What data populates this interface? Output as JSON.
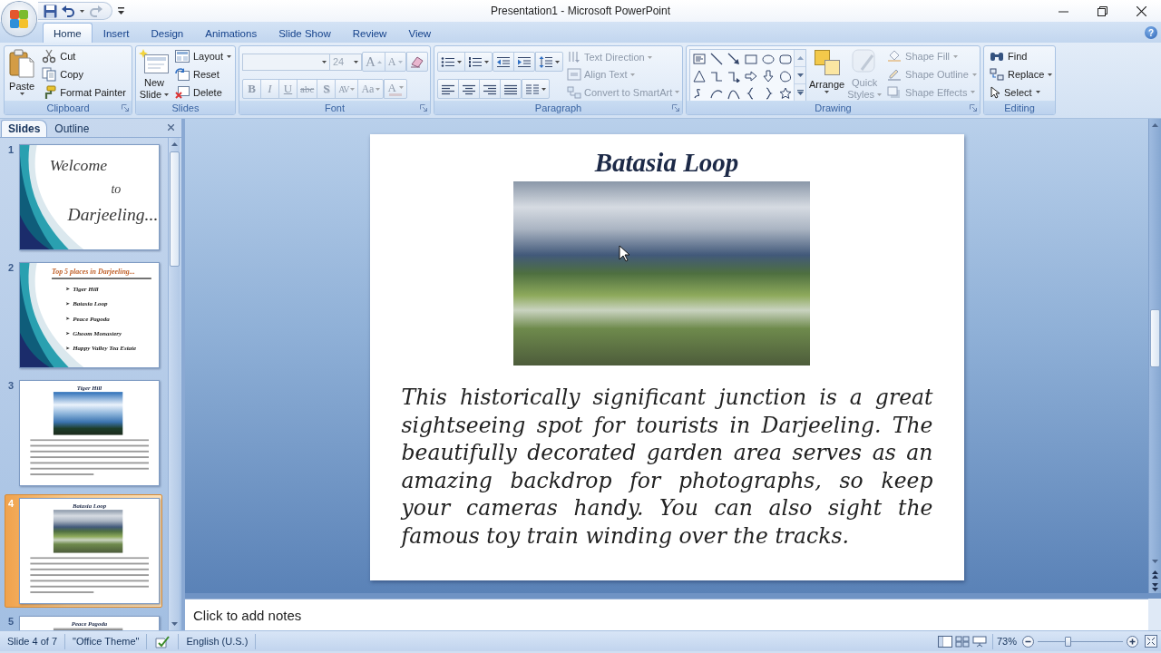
{
  "window": {
    "title": "Presentation1 - Microsoft PowerPoint",
    "help": "?"
  },
  "tabs": [
    {
      "label": "Home",
      "selected": true
    },
    {
      "label": "Insert",
      "selected": false
    },
    {
      "label": "Design",
      "selected": false
    },
    {
      "label": "Animations",
      "selected": false
    },
    {
      "label": "Slide Show",
      "selected": false
    },
    {
      "label": "Review",
      "selected": false
    },
    {
      "label": "View",
      "selected": false
    }
  ],
  "ribbon": {
    "clipboard": {
      "label": "Clipboard",
      "paste": "Paste",
      "cut": "Cut",
      "copy": "Copy",
      "format_painter": "Format Painter"
    },
    "slides": {
      "label": "Slides",
      "new_slide": [
        "New",
        "Slide"
      ],
      "layout": "Layout",
      "reset": "Reset",
      "delete": "Delete"
    },
    "font": {
      "label": "Font",
      "disabled": true,
      "font_size": "24",
      "grow": "A",
      "shrink": "A",
      "format_buttons": [
        {
          "kind": "bold",
          "label": "B"
        },
        {
          "kind": "italic",
          "label": "I"
        },
        {
          "kind": "underline",
          "label": "U"
        },
        {
          "kind": "strikethrough",
          "label": "abc"
        },
        {
          "kind": "shadow",
          "label": "S"
        },
        {
          "kind": "spacing",
          "label": "AV"
        },
        {
          "kind": "case",
          "label": "Aa"
        }
      ],
      "font_color": "A"
    },
    "paragraph": {
      "label": "Paragraph",
      "commands": [
        {
          "label": "Text Direction",
          "disabled": true
        },
        {
          "label": "Align Text",
          "disabled": true
        },
        {
          "label": "Convert to SmartArt",
          "disabled": true
        }
      ]
    },
    "drawing": {
      "label": "Drawing",
      "arrange": "Arrange",
      "quick_styles": {
        "label": [
          "Quick",
          "Styles"
        ],
        "disabled": true
      },
      "shape_commands": [
        {
          "label": "Shape Fill",
          "disabled": true
        },
        {
          "label": "Shape Outline",
          "disabled": true
        },
        {
          "label": "Shape Effects",
          "disabled": true
        }
      ]
    },
    "editing": {
      "label": "Editing",
      "commands": [
        {
          "label": "Find",
          "disabled": false
        },
        {
          "label": "Replace",
          "disabled": false
        },
        {
          "label": "Select",
          "disabled": false
        }
      ]
    }
  },
  "slides_pane": {
    "tabs": [
      {
        "label": "Slides",
        "selected": true
      },
      {
        "label": "Outline",
        "selected": false
      }
    ],
    "slides": [
      {
        "number": "1",
        "selected": false,
        "kind": "title",
        "lines": [
          "Welcome",
          "to",
          "Darjeeling..."
        ]
      },
      {
        "number": "2",
        "selected": false,
        "kind": "bullets",
        "title": "Top 5 places in Darjeeling...",
        "bullets": [
          "Tiger Hill",
          "Batasia Loop",
          "Peace Pagoda",
          "Ghoom Monastery",
          "Happy Valley Tea Estate"
        ]
      },
      {
        "number": "3",
        "selected": false,
        "kind": "picture_text",
        "title": "Tiger Hill"
      },
      {
        "number": "4",
        "selected": true,
        "kind": "picture_text",
        "title": "Batasia Loop"
      },
      {
        "number": "5",
        "selected": false,
        "kind": "picture",
        "title": "Peace Pagoda"
      }
    ]
  },
  "editor": {
    "slide": {
      "title": "Batasia Loop",
      "body": "This historically significant junction is a great sightseeing spot for tourists in Darjeeling. The beautifully decorated garden area serves as an amazing backdrop for photographs, so keep your cameras handy. You can also sight the famous toy train winding over the tracks."
    },
    "notes": {
      "placeholder": "Click to add notes"
    }
  },
  "status_bar": {
    "slide_info": "Slide 4 of 7",
    "theme": "\"Office Theme\"",
    "language": "English (U.S.)",
    "zoom": {
      "label": "73%",
      "level": 0.36
    }
  }
}
